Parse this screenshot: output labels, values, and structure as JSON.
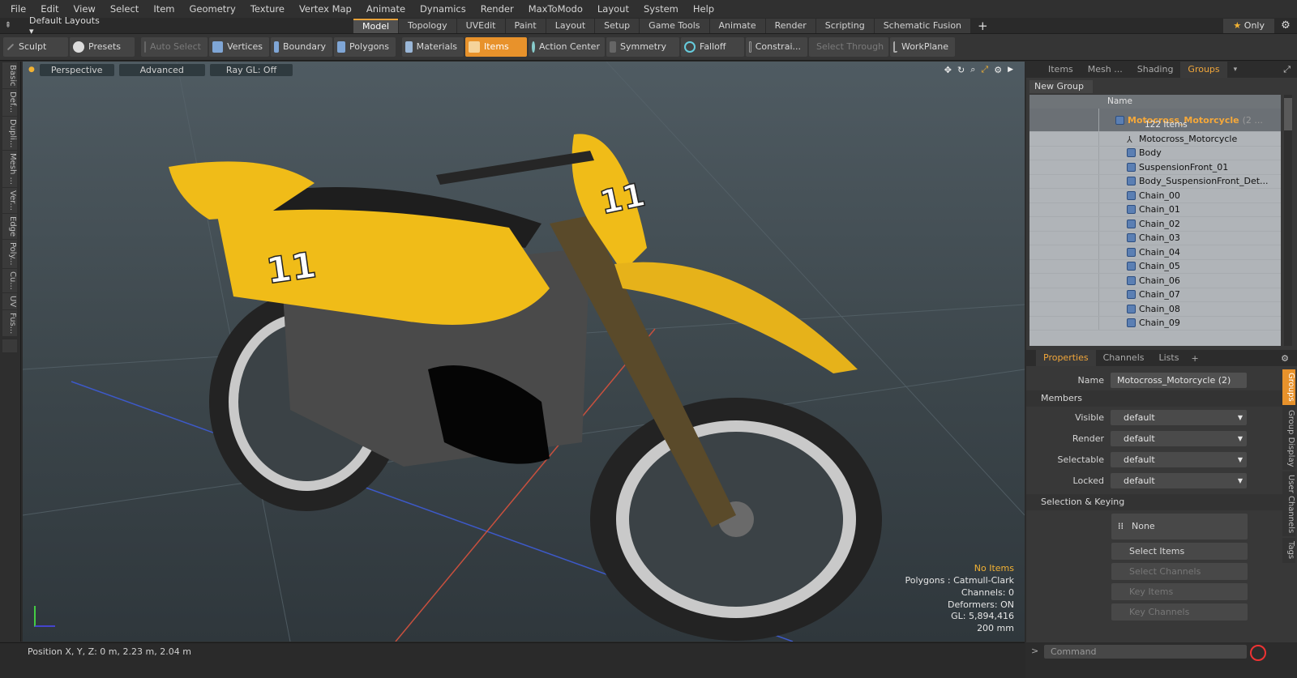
{
  "menu": [
    "File",
    "Edit",
    "View",
    "Select",
    "Item",
    "Geometry",
    "Texture",
    "Vertex Map",
    "Animate",
    "Dynamics",
    "Render",
    "MaxToModo",
    "Layout",
    "System",
    "Help"
  ],
  "layouts": {
    "default_label": "Default Layouts",
    "tabs": [
      "Model",
      "Topology",
      "UVEdit",
      "Paint",
      "Layout",
      "Setup",
      "Game Tools",
      "Animate",
      "Render",
      "Scripting",
      "Schematic Fusion"
    ],
    "active": "Model",
    "only_label": "Only"
  },
  "toolbar": {
    "sculpt": "Sculpt",
    "presets": "Presets",
    "auto_select": "Auto Select",
    "vertices": "Vertices",
    "boundary": "Boundary",
    "polygons": "Polygons",
    "materials": "Materials",
    "items": "Items",
    "action_center": "Action Center",
    "symmetry": "Symmetry",
    "falloff": "Falloff",
    "constraints": "Constrai...",
    "select_through": "Select Through",
    "workplane": "WorkPlane"
  },
  "left_tabs": [
    "Basic",
    "Def...",
    "Dupli...",
    "Mesh ...",
    "Ver...",
    "Edge",
    "Poly...",
    "Cu...",
    "UV",
    "Fus..."
  ],
  "viewport": {
    "view": "Perspective",
    "shading": "Advanced",
    "raygl": "Ray GL: Off",
    "stats": {
      "selection": "No Items",
      "polygons": "Polygons : Catmull-Clark",
      "channels": "Channels: 0",
      "deformers": "Deformers: ON",
      "gl": "GL: 5,894,416",
      "scale": "200 mm"
    }
  },
  "status": {
    "position": "Position X, Y, Z:   0 m, 2.23 m, 2.04 m"
  },
  "item_panel": {
    "tabs": [
      "Items",
      "Mesh ...",
      "Shading",
      "Groups"
    ],
    "active": "Groups",
    "new_group": "New Group",
    "name_header": "Name",
    "group": {
      "name": "Motocross_Motorcycle",
      "suffix": "(2 ...",
      "count": "122 Items"
    },
    "items": [
      "Motocross_Motorcycle",
      "Body",
      "SuspensionFront_01",
      "Body_SuspensionFront_Det...",
      "Chain_00",
      "Chain_01",
      "Chain_02",
      "Chain_03",
      "Chain_04",
      "Chain_05",
      "Chain_06",
      "Chain_07",
      "Chain_08",
      "Chain_09"
    ]
  },
  "properties": {
    "tabs": [
      "Properties",
      "Channels",
      "Lists"
    ],
    "active": "Properties",
    "name_label": "Name",
    "name_value": "Motocross_Motorcycle (2)",
    "members_label": "Members",
    "fields": [
      {
        "label": "Visible",
        "value": "default"
      },
      {
        "label": "Render",
        "value": "default"
      },
      {
        "label": "Selectable",
        "value": "default"
      },
      {
        "label": "Locked",
        "value": "default"
      }
    ],
    "sel_keying_label": "Selection & Keying",
    "none_label": "None",
    "buttons": [
      "Select Items",
      "Select Channels",
      "Key Items",
      "Key Channels"
    ],
    "side_tabs": [
      "Groups",
      "Group Display",
      "User Channels",
      "Tags"
    ]
  },
  "command": {
    "placeholder": "Command"
  }
}
